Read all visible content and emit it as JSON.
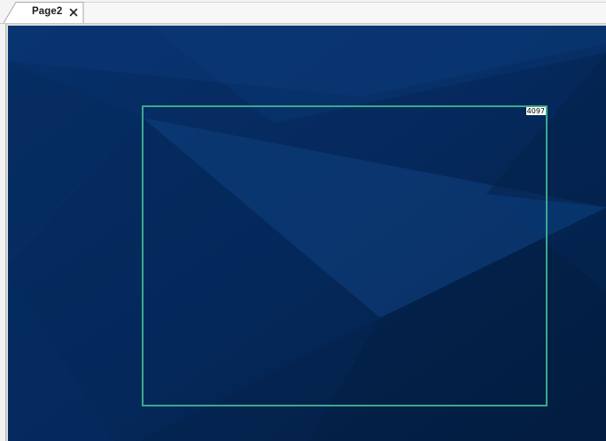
{
  "tabs": [
    {
      "label": "Page2",
      "active": true,
      "close_icon": "close-icon"
    }
  ],
  "canvas": {
    "background_color": "#062a58",
    "selected_element": {
      "id_label": "4097",
      "border_color": "#3aa98a"
    }
  }
}
